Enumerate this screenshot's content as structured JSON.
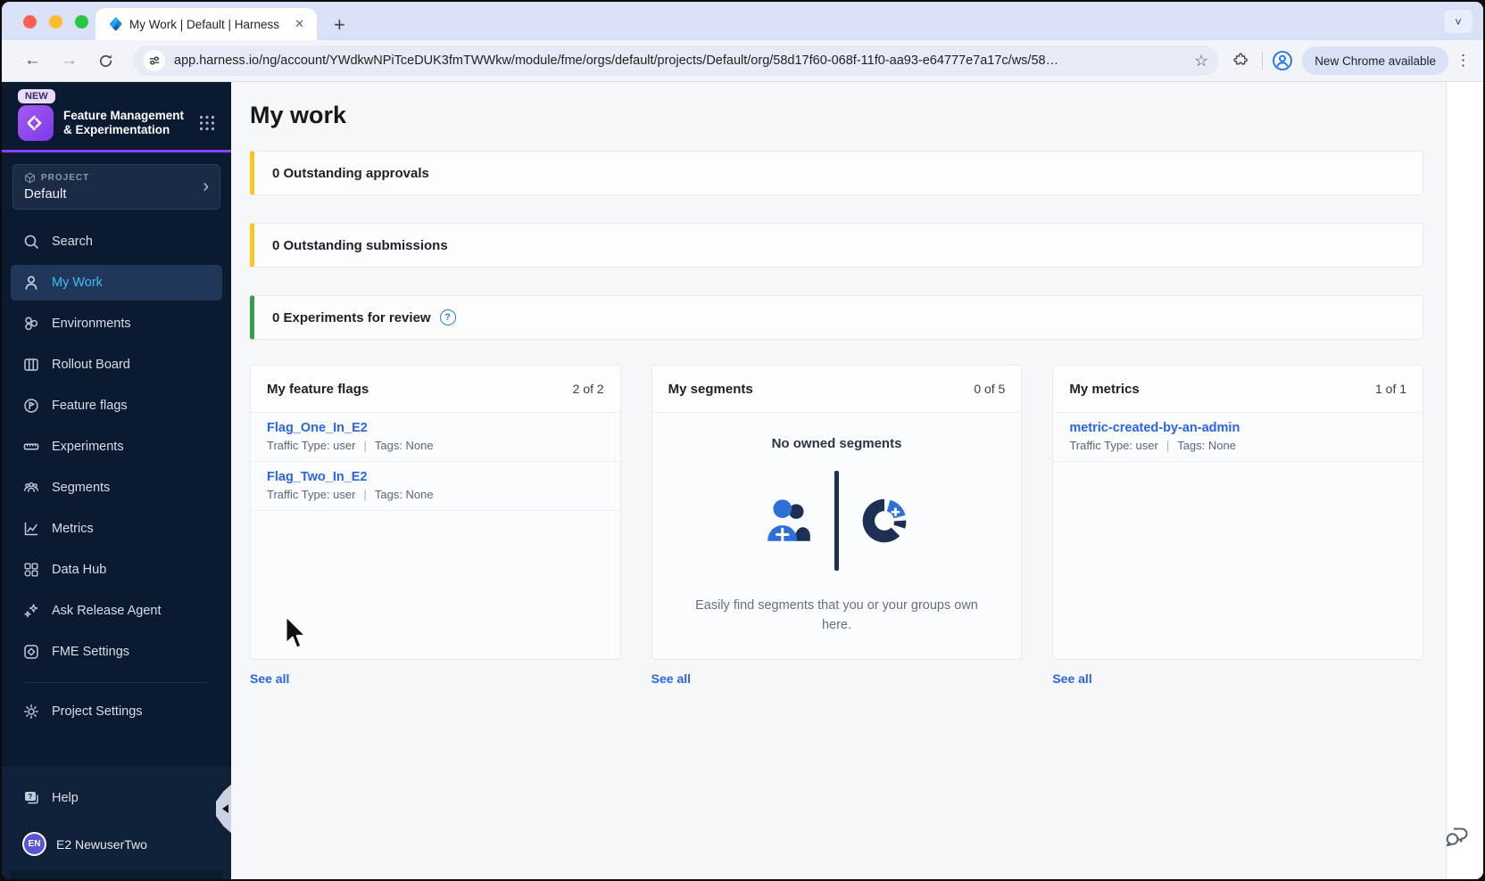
{
  "icons": {
    "plus": "+",
    "close": "✕",
    "back": "←",
    "forward": "→",
    "star": "☆",
    "dots": "⋮",
    "chev_down": "˅",
    "chev_right": "›",
    "question": "?"
  },
  "browser": {
    "tab_title": "My Work | Default | Harness",
    "url": "app.harness.io/ng/account/YWdkwNPiTceDUK3fmTWWkw/module/fme/orgs/default/projects/Default/org/58d17f60-068f-11f0-aa93-e64777e7a17c/ws/58…",
    "chip": "New Chrome available"
  },
  "sidebar": {
    "badge": "NEW",
    "module": "Feature Management & Experimentation",
    "project_label": "PROJECT",
    "project_name": "Default",
    "items": [
      {
        "label": "Search"
      },
      {
        "label": "My Work"
      },
      {
        "label": "Environments"
      },
      {
        "label": "Rollout Board"
      },
      {
        "label": "Feature flags"
      },
      {
        "label": "Experiments"
      },
      {
        "label": "Segments"
      },
      {
        "label": "Metrics"
      },
      {
        "label": "Data Hub"
      },
      {
        "label": "Ask Release Agent"
      },
      {
        "label": "FME Settings"
      }
    ],
    "footer": {
      "settings": "Project Settings",
      "help": "Help",
      "user_initials": "EN",
      "user_name": "E2 NewuserTwo"
    }
  },
  "main": {
    "title": "My work",
    "meta_sep": "|",
    "alerts": [
      {
        "label": "0 Outstanding approvals"
      },
      {
        "label": "0 Outstanding submissions"
      },
      {
        "label": "0 Experiments for review"
      }
    ],
    "cards": [
      {
        "title": "My feature flags",
        "count": "2 of 2",
        "see_all": "See all",
        "items": [
          {
            "name": "Flag_One_In_E2",
            "traffic": "Traffic Type: user",
            "tags": "Tags: None"
          },
          {
            "name": "Flag_Two_In_E2",
            "traffic": "Traffic Type: user",
            "tags": "Tags: None"
          }
        ]
      },
      {
        "title": "My segments",
        "count": "0 of 5",
        "see_all": "See all",
        "empty": {
          "title": "No owned segments",
          "desc": "Easily find segments that you or your groups own here."
        }
      },
      {
        "title": "My metrics",
        "count": "1 of 1",
        "see_all": "See all",
        "items": [
          {
            "name": "metric-created-by-an-admin",
            "traffic": "Traffic Type: user",
            "tags": "Tags: None"
          }
        ]
      }
    ]
  },
  "colors": {
    "accent_yellow": "#fcc41d",
    "accent_green": "#30a04d",
    "link_blue": "#2a64e6",
    "module_purple": "#8a3ffc",
    "active_item_blue": "#3fbcf8"
  }
}
